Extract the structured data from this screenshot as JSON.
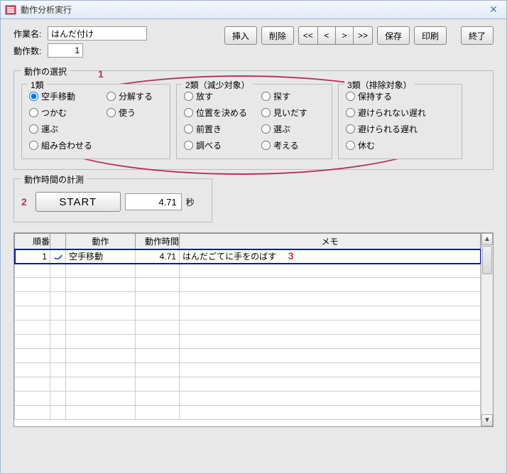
{
  "window": {
    "title": "動作分析実行"
  },
  "header": {
    "work_label": "作業名:",
    "work_value": "はんだ付け",
    "count_label": "動作数:",
    "count_value": "1"
  },
  "toolbar": {
    "insert": "挿入",
    "delete": "削除",
    "nav_first": "<<",
    "nav_prev": "<",
    "nav_next": ">",
    "nav_last": ">>",
    "save": "保存",
    "print": "印刷",
    "exit": "終了"
  },
  "selection": {
    "legend": "動作の選択",
    "group1": {
      "title": "1類",
      "col1": [
        "空手移動",
        "つかむ",
        "運ぶ",
        "組み合わせる"
      ],
      "col2": [
        "分解する",
        "使う"
      ]
    },
    "group2": {
      "title": "2類（減少対象）",
      "col1": [
        "放す",
        "位置を決める",
        "前置き",
        "調べる"
      ],
      "col2": [
        "探す",
        "見いだす",
        "選ぶ",
        "考える"
      ]
    },
    "group3": {
      "title": "3類（排除対象）",
      "col1": [
        "保持する",
        "避けられない遅れ",
        "避けられる遅れ",
        "休む"
      ]
    },
    "selected": "空手移動"
  },
  "timing": {
    "legend": "動作時間の計測",
    "start": "START",
    "value": "4.71",
    "unit": "秒"
  },
  "grid": {
    "headers": {
      "order": "順番",
      "action": "動作",
      "time": "動作時間",
      "memo": "メモ"
    },
    "rows": [
      {
        "order": "1",
        "action": "空手移動",
        "time": "4.71",
        "memo": "はんだごてに手をのばす"
      }
    ]
  },
  "annotations": {
    "a1": "1",
    "a2": "2",
    "a3": "3"
  }
}
